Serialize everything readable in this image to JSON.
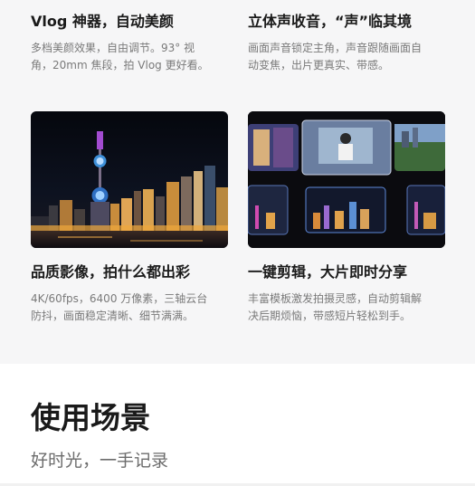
{
  "features": [
    {
      "title": "Vlog 神器，自动美颜",
      "desc_lines": [
        "多档美颜效果，自由调节。93° 视",
        "角，20mm 焦段，拍 Vlog 更好看。"
      ]
    },
    {
      "title": "立体声收音，“声”临其境",
      "desc_lines": [
        "画面声音锁定主角，声音跟随画面自",
        "动变焦，出片更真实、带感。"
      ]
    },
    {
      "title": "品质影像，拍什么都出彩",
      "desc_lines": [
        "4K/60fps，6400 万像素，三轴云台",
        "防抖，画面稳定清晰、细节满满。"
      ]
    },
    {
      "title": "一键剪辑，大片即时分享",
      "desc_lines": [
        "丰富模板激发拍摄灵感，自动剪辑解",
        "决后期烦恼，带感短片轻松到手。"
      ]
    }
  ],
  "images": [
    {
      "icon": "night-skyline-photo"
    },
    {
      "icon": "video-clips-collage-photo"
    }
  ],
  "scenes": {
    "title": "使用场景",
    "subtitle": "好时光，一手记录"
  }
}
